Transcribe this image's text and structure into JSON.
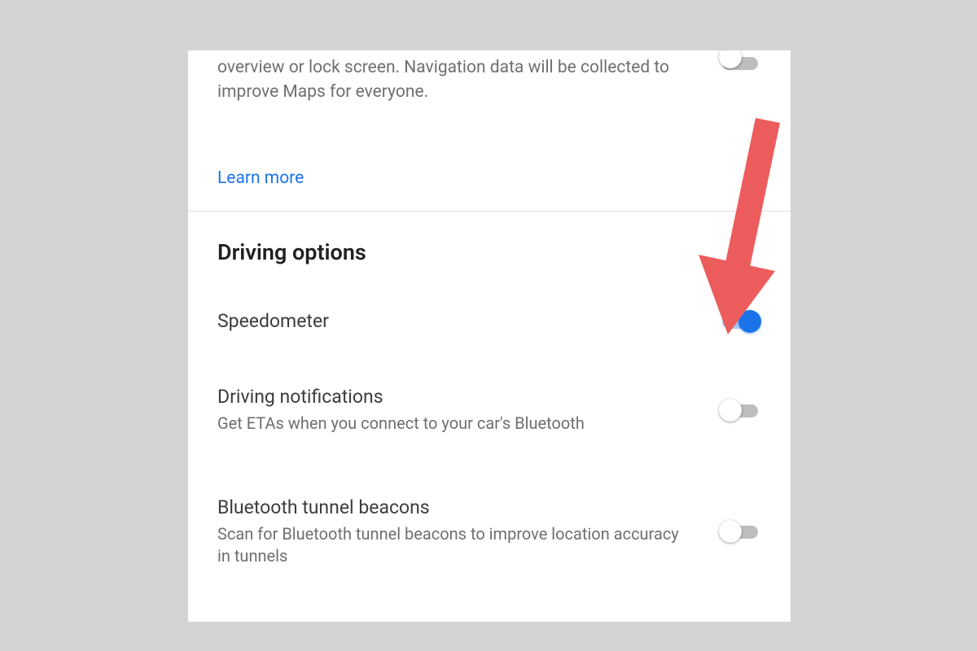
{
  "top_partial": {
    "description_fragment": "overview or lock screen. Navigation data will be collected to improve Maps for everyone.",
    "learn_more_label": "Learn more",
    "toggle_state": false
  },
  "section": {
    "header": "Driving options",
    "items": [
      {
        "title": "Speedometer",
        "subtitle": "",
        "toggle_state": true
      },
      {
        "title": "Driving notifications",
        "subtitle": "Get ETAs when you connect to your car's Bluetooth",
        "toggle_state": false
      },
      {
        "title": "Bluetooth tunnel beacons",
        "subtitle": "Scan for Bluetooth tunnel beacons to improve location accuracy in tunnels",
        "toggle_state": false
      }
    ]
  },
  "annotation": {
    "type": "arrow",
    "color": "#ed5c5c",
    "points_to": "speedometer-toggle"
  }
}
